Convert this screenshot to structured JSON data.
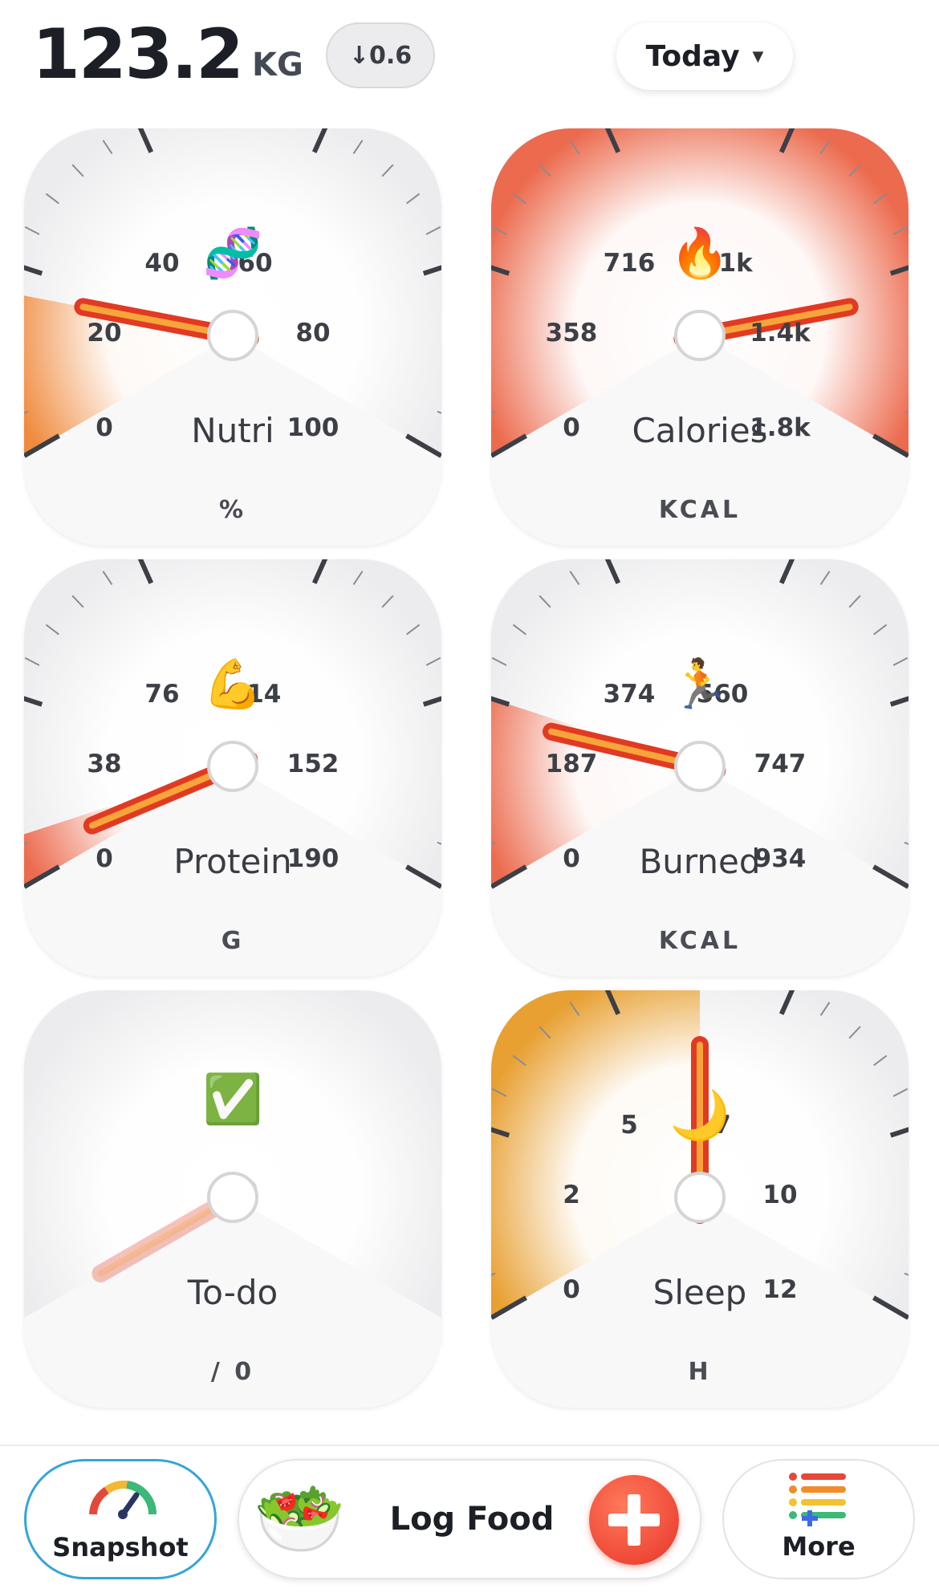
{
  "header": {
    "weight_value": "123.2",
    "weight_unit": "KG",
    "weight_delta": "↓0.6",
    "period_label": "Today",
    "period_caret": "▼"
  },
  "gauges": [
    {
      "id": "nutri",
      "name": "Nutri",
      "unit": "%",
      "emoji": "🧬",
      "ticks": [
        "0",
        "20",
        "40",
        "60",
        "80",
        "100"
      ],
      "value_fraction": 0.17,
      "fill_color": "#f08a3c",
      "fill_fraction": 0.17,
      "needle_visible": true
    },
    {
      "id": "calories",
      "name": "Calories",
      "unit": "KCAL",
      "emoji": "🔥",
      "ticks": [
        "0",
        "358",
        "716",
        "1.1k",
        "1.4k",
        "1.8k"
      ],
      "value_fraction": 0.83,
      "fill_color": "#ec6a4d",
      "fill_fraction": 1.0,
      "needle_visible": true
    },
    {
      "id": "protein",
      "name": "Protein",
      "unit": "G",
      "emoji": "💪",
      "ticks": [
        "0",
        "38",
        "76",
        "114",
        "152",
        "190"
      ],
      "value_fraction": 0.03,
      "fill_color": "#ec6a4d",
      "fill_fraction": 0.05,
      "needle_visible": true
    },
    {
      "id": "burned",
      "name": "Burned",
      "unit": "KCAL",
      "emoji": "🏃",
      "ticks": [
        "0",
        "187",
        "374",
        "560",
        "747",
        "934"
      ],
      "value_fraction": 0.18,
      "fill_color": "#ec6a4d",
      "fill_fraction": 0.2,
      "needle_visible": true
    },
    {
      "id": "todo",
      "name": "To-do",
      "unit": "/ 0",
      "emoji": "✅",
      "ticks": [
        "",
        "",
        "",
        "",
        "",
        ""
      ],
      "value_fraction": 0.0,
      "fill_color": "#f3b39c",
      "fill_fraction": 0.0,
      "needle_visible": true,
      "faded": true
    },
    {
      "id": "sleep",
      "name": "Sleep",
      "unit": "H",
      "emoji": "🌙",
      "ticks": [
        "0",
        "2",
        "5",
        "7",
        "10",
        "12"
      ],
      "value_fraction": 0.5,
      "fill_color": "#e8a032",
      "fill_fraction": 0.5,
      "needle_visible": true
    }
  ],
  "bottom": {
    "snapshot_label": "Snapshot",
    "logfood_label": "Log Food",
    "more_label": "More",
    "logfood_emoji": "🥗",
    "plus_symbol": "+"
  }
}
